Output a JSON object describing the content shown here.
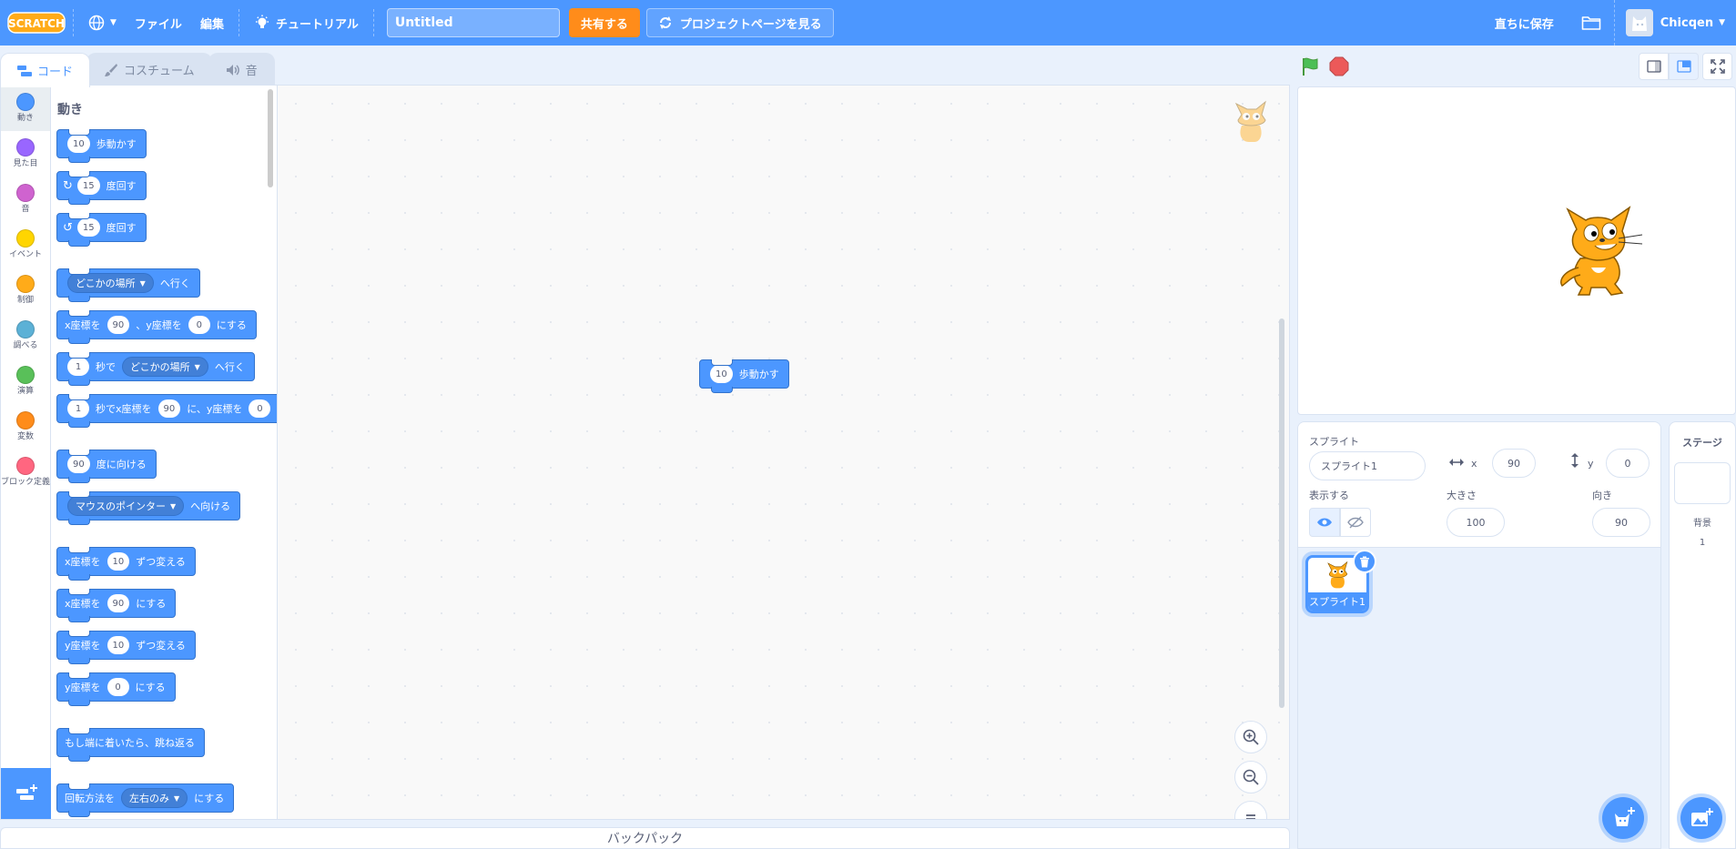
{
  "menubar": {
    "logo_text": "SCRATCH",
    "file": "ファイル",
    "edit": "編集",
    "tutorial": "チュートリアル",
    "project_title": "Untitled",
    "share": "共有する",
    "project_page": "プロジェクトページを見る",
    "save_now": "直ちに保存",
    "username": "Chicqen"
  },
  "tabs": {
    "code": "コード",
    "costumes": "コスチューム",
    "sounds": "音"
  },
  "categories": [
    {
      "label": "動き",
      "color": "#4c97ff"
    },
    {
      "label": "見た目",
      "color": "#9966ff"
    },
    {
      "label": "音",
      "color": "#cf63cf"
    },
    {
      "label": "イベント",
      "color": "#ffd500"
    },
    {
      "label": "制御",
      "color": "#ffab19"
    },
    {
      "label": "調べる",
      "color": "#5cb1d6"
    },
    {
      "label": "演算",
      "color": "#59c059"
    },
    {
      "label": "変数",
      "color": "#ff8c1a"
    },
    {
      "label": "ブロック定義",
      "color": "#ff6680"
    }
  ],
  "palette": {
    "title": "動き",
    "move_steps": {
      "value": "10",
      "text": "歩動かす"
    },
    "turn_right": {
      "value": "15",
      "text": "度回す"
    },
    "turn_left": {
      "value": "15",
      "text": "度回す"
    },
    "goto": {
      "menu": "どこかの場所",
      "text": "へ行く"
    },
    "goto_xy": {
      "t1": "x座標を",
      "x": "90",
      "t2": "、y座標を",
      "y": "0",
      "t3": "にする"
    },
    "glide_to": {
      "secs": "1",
      "t1": "秒で",
      "menu": "どこかの場所",
      "t2": "へ行く"
    },
    "glide_xy": {
      "secs": "1",
      "t1": "秒でx座標を",
      "x": "90",
      "t2": "に、y座標を",
      "y": "0"
    },
    "point_dir": {
      "value": "90",
      "text": "度に向ける"
    },
    "point_towards": {
      "menu": "マウスのポインター",
      "text": "へ向ける"
    },
    "change_x": {
      "t1": "x座標を",
      "value": "10",
      "t2": "ずつ変える"
    },
    "set_x": {
      "t1": "x座標を",
      "value": "90",
      "t2": "にする"
    },
    "change_y": {
      "t1": "y座標を",
      "value": "10",
      "t2": "ずつ変える"
    },
    "set_y": {
      "t1": "y座標を",
      "value": "0",
      "t2": "にする"
    },
    "bounce": {
      "text": "もし端に着いたら、跳ね返る"
    },
    "rotation_style": {
      "t1": "回転方法を",
      "menu": "左右のみ",
      "t2": "にする"
    }
  },
  "workspace": {
    "block": {
      "value": "10",
      "text": "歩動かす"
    }
  },
  "backpack": "バックパック",
  "sprite_info": {
    "sprite_label": "スプライト",
    "sprite_name": "スプライト1",
    "x_label": "x",
    "x_value": "90",
    "y_label": "y",
    "y_value": "0",
    "show_label": "表示する",
    "size_label": "大きさ",
    "size_value": "100",
    "direction_label": "向き",
    "direction_value": "90"
  },
  "sprite_list": [
    {
      "name": "スプライト1"
    }
  ],
  "stage_pane": {
    "title": "ステージ",
    "backdrops_label": "背景",
    "backdrops_count": "1"
  },
  "colors": {
    "accent": "#4c97ff",
    "share": "#ff8c1a",
    "flag": "#4cbf56",
    "stop": "#ec5959"
  }
}
